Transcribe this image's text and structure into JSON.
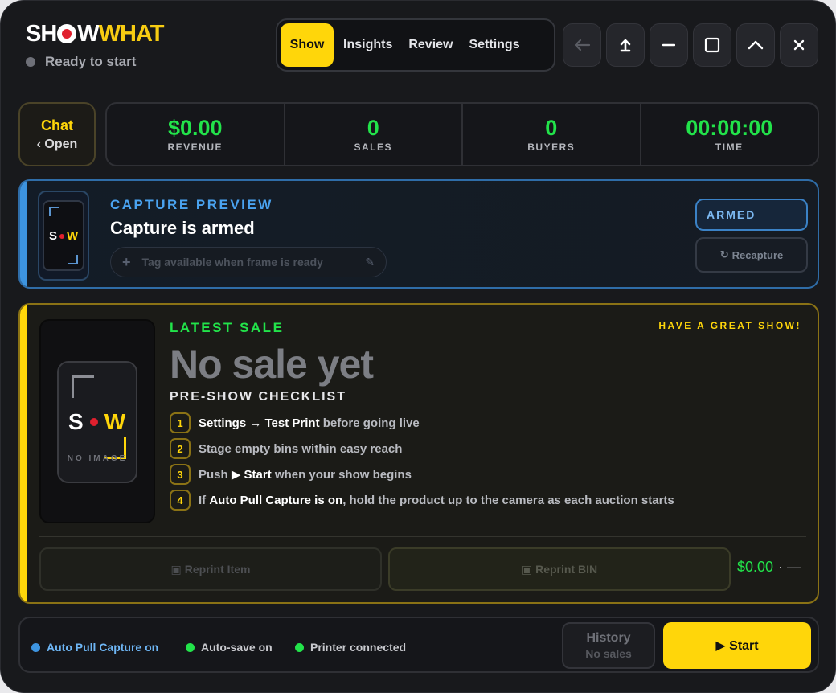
{
  "app": {
    "logo_part1": "SH",
    "logo_part2": "W",
    "logo_part3": "WHAT",
    "status": "Ready to start"
  },
  "tabs": [
    {
      "label": "Show",
      "active": true
    },
    {
      "label": "Insights",
      "active": false
    },
    {
      "label": "Review",
      "active": false
    },
    {
      "label": "Settings",
      "active": false
    }
  ],
  "window_controls": {
    "back": "←",
    "share": "⇧",
    "minimize": "—",
    "maximize": "☐",
    "collapse": "︿",
    "close": "✕"
  },
  "chat": {
    "title": "Chat",
    "action": "‹ Open"
  },
  "stats": [
    {
      "value": "$0.00",
      "label": "REVENUE"
    },
    {
      "value": "0",
      "label": "SALES"
    },
    {
      "value": "0",
      "label": "BUYERS"
    },
    {
      "value": "00:00:00",
      "label": "TIME"
    }
  ],
  "capture": {
    "kicker": "CAPTURE PREVIEW",
    "title": "Capture is armed",
    "tag_placeholder": "Tag available when frame is ready",
    "armed_label": "ARMED",
    "recapture_label": "Recapture",
    "thumb_s": "S",
    "thumb_w": "W"
  },
  "latest_sale": {
    "kicker": "LATEST SALE",
    "greeting": "HAVE A GREAT SHOW!",
    "headline": "No sale yet",
    "no_image": "NO IMAGE",
    "img_s": "S",
    "img_w": "W",
    "checklist_title": "PRE-SHOW CHECKLIST",
    "checklist": [
      {
        "num": "1",
        "bold": "Settings → Test Print",
        "rest": " before going live",
        "pre": ""
      },
      {
        "num": "2",
        "bold": "",
        "rest": "Stage empty bins within easy reach",
        "pre": ""
      },
      {
        "num": "3",
        "bold": "▶ Start",
        "rest": " when your show begins",
        "pre": "Push "
      },
      {
        "num": "4",
        "bold": "Auto Pull Capture is on",
        "rest": ", hold the product up to the camera as each auction starts",
        "pre": "If "
      }
    ],
    "reprint_item": "Reprint Item",
    "reprint_bin": "Reprint BIN",
    "price": "$0.00",
    "price_suffix": "· —"
  },
  "footer": {
    "indicators": [
      {
        "label": "Auto Pull Capture on",
        "color": "#3d94e0"
      },
      {
        "label": "Auto-save on",
        "color": "#22e34a"
      },
      {
        "label": "Printer connected",
        "color": "#22e34a"
      }
    ],
    "history_title": "History",
    "history_sub": "No sales",
    "start_label": "▶ Start"
  },
  "colors": {
    "accent_yellow": "#ffd60a",
    "accent_green": "#22e34a",
    "accent_blue": "#3d94e0",
    "background": "#18191c"
  }
}
